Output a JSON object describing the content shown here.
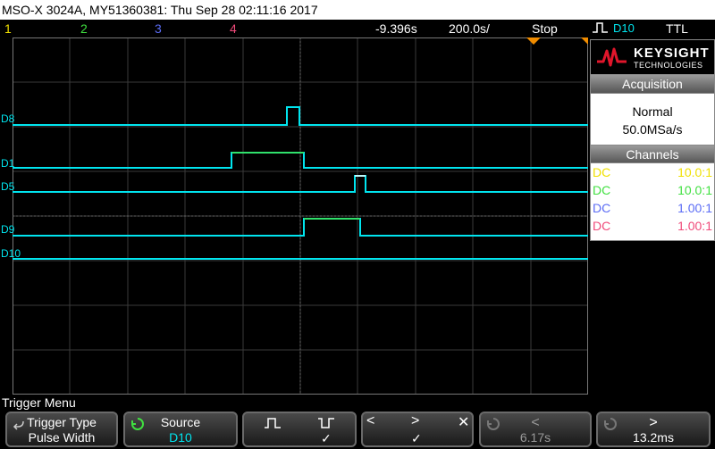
{
  "title": "MSO-X 3024A, MY51360381: Thu Sep 28 02:11:16 2017",
  "status": {
    "ch1": "1",
    "ch2": "2",
    "ch3": "3",
    "ch4": "4",
    "delay": "-9.396s",
    "timebase": "200.0s/",
    "run_state": "Stop",
    "trigger_source": "D10",
    "trigger_level": "TTL"
  },
  "colors": {
    "ch1": "#f0e000",
    "ch2": "#40e040",
    "ch3": "#5b6cf5",
    "ch4": "#f04a7a",
    "digital": "#00e5ef"
  },
  "digital_channels": [
    {
      "label": "D8"
    },
    {
      "label": "D1"
    },
    {
      "label": "D5"
    },
    {
      "label": "D9"
    },
    {
      "label": "D10"
    }
  ],
  "logo": {
    "brand": "KEYSIGHT",
    "sub": "TECHNOLOGIES"
  },
  "acquisition": {
    "header": "Acquisition",
    "mode": "Normal",
    "rate": "50.0MSa/s"
  },
  "channels": {
    "header": "Channels",
    "rows": [
      {
        "coupling": "DC",
        "ratio": "10.0:1"
      },
      {
        "coupling": "DC",
        "ratio": "10.0:1"
      },
      {
        "coupling": "DC",
        "ratio": "1.00:1"
      },
      {
        "coupling": "DC",
        "ratio": "1.00:1"
      }
    ]
  },
  "menu": {
    "title": "Trigger Menu",
    "trigger_type_label": "Trigger Type",
    "trigger_type_value": "Pulse Width",
    "source_label": "Source",
    "source_value": "D10",
    "polarity_check": "✓",
    "qualifier_check": "✓",
    "time_value_1": "6.17s",
    "time_value_2": "13.2ms"
  }
}
